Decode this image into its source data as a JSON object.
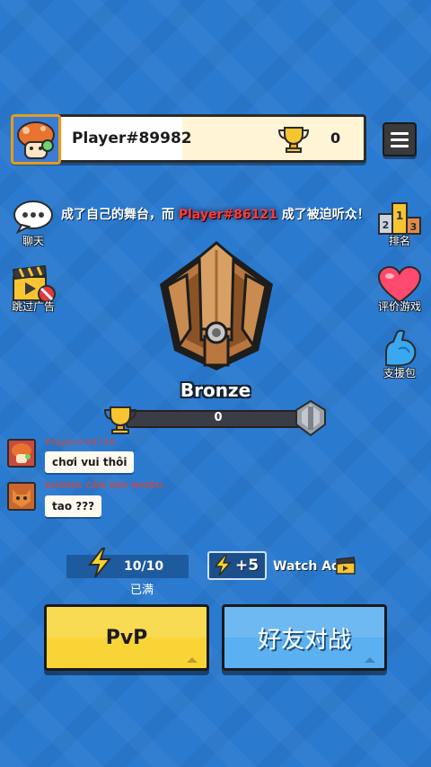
{
  "player": {
    "name": "Player#89982",
    "trophies": "0"
  },
  "side": {
    "chat_label": "聊天",
    "skip_ad_label": "跳过广告",
    "rank_label": "排名",
    "rate_label": "评价游戏",
    "support_label": "支援包"
  },
  "announcement": {
    "prefix": "成了自己的舞台，而",
    "player": "Player#86121",
    "suffix": "成了被迫听众！"
  },
  "rank": {
    "name": "Bronze",
    "progress_text": "0",
    "progress": 0
  },
  "chat": {
    "messages": [
      {
        "name": "Player#36738",
        "text": "chơi vui thôi"
      },
      {
        "name": "KHÔNG CẦN NÓI NHIỀU",
        "text": "tao ???"
      }
    ]
  },
  "energy": {
    "count": "10/10",
    "status": "已满",
    "bonus": "+5",
    "watch_ad": "Watch Ad"
  },
  "buttons": {
    "pvp": "PvP",
    "friend_battle": "好友对战"
  },
  "colors": {
    "background": "#2a7ad0",
    "pvp_button": "#f8d436",
    "friend_button": "#5ab0f0",
    "highlight_name": "#ff3b3b"
  }
}
